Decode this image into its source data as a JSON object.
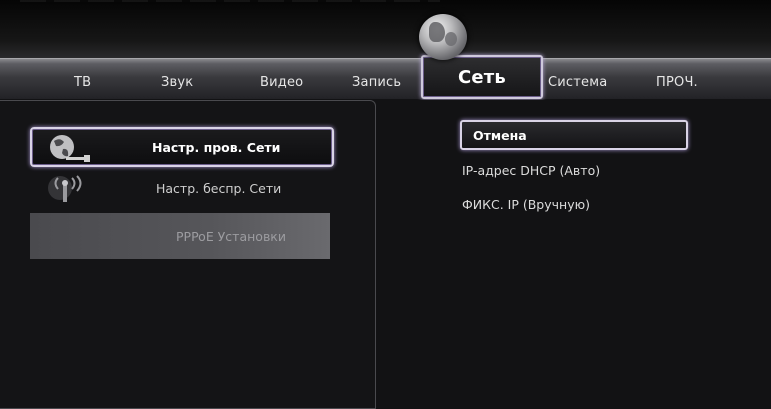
{
  "tabs": [
    {
      "label": "ТВ",
      "active": false
    },
    {
      "label": "Звук",
      "active": false
    },
    {
      "label": "Видео",
      "active": false
    },
    {
      "label": "Запись",
      "active": false
    },
    {
      "label": "Сеть",
      "active": true
    },
    {
      "label": "Система",
      "active": false
    },
    {
      "label": "ПРОЧ.",
      "active": false
    }
  ],
  "left_menu": {
    "items": [
      {
        "label": "Настр. пров. Сети",
        "icon": "wired-network-globe-icon",
        "selected": true
      },
      {
        "label": "Настр. беспр. Сети",
        "icon": "wireless-antenna-icon",
        "selected": false
      },
      {
        "label": "PPPoE Установки",
        "icon": "",
        "selected": false,
        "disabled": true
      }
    ]
  },
  "options": {
    "items": [
      {
        "label": "Отмена",
        "selected": true
      },
      {
        "label": "IP-адрес DHCP (Авто)",
        "selected": false
      },
      {
        "label": "ФИКС. IP (Вручную)",
        "selected": false
      }
    ]
  },
  "colors": {
    "highlight_border": "#d9d3e6",
    "highlight_glow": "#a897d0",
    "background": "#121214",
    "tabbar": "#3a3a3e"
  }
}
